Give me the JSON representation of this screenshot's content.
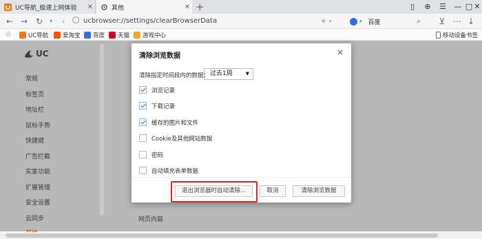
{
  "browser": {
    "tabs": [
      {
        "label": "UC导航_极速上网体验",
        "active": false
      },
      {
        "label": "其他",
        "active": true
      }
    ],
    "new_tab_symbol": "+",
    "window_controls": [
      "▯",
      "⊕",
      "☰",
      "—",
      "□",
      "✕"
    ],
    "address": "ucbrowser://settings/clearBrowserData",
    "search_engine": "百度",
    "bookmarks": [
      {
        "label": "UC导航",
        "icon_color": "#f07a16"
      },
      {
        "label": "爱淘宝",
        "icon_color": "#ff5000"
      },
      {
        "label": "百度",
        "icon_color": "#2f6fe0"
      },
      {
        "label": "天猫",
        "icon_color": "#d4001b"
      },
      {
        "label": "游戏中心",
        "icon_color": "#f2a623"
      }
    ],
    "mobile_bookmarks": "移动设备书签"
  },
  "settings": {
    "logo": "UC",
    "nav": [
      {
        "label": "常规"
      },
      {
        "label": "标签页"
      },
      {
        "label": "地址栏"
      },
      {
        "label": "鼠标手势"
      },
      {
        "label": "快捷键"
      },
      {
        "label": "广告拦截"
      },
      {
        "label": "实家功能"
      },
      {
        "label": "扩展管理"
      },
      {
        "label": "安全设置"
      },
      {
        "label": "云同步"
      },
      {
        "label": "其他"
      }
    ],
    "section_title": "网页内容"
  },
  "dialog": {
    "title": "清除浏览数据",
    "close": "×",
    "range_label": "清除指定时间段内的数据：",
    "range_value": "过去1周",
    "options": [
      {
        "label": "浏览记录",
        "checked": true
      },
      {
        "label": "下载记录",
        "checked": true
      },
      {
        "label": "缓存的图片和文件",
        "checked": true
      },
      {
        "label": "Cookie及其他网站数据",
        "checked": false
      },
      {
        "label": "密码",
        "checked": false
      },
      {
        "label": "自动填充表单数据",
        "checked": false
      }
    ],
    "buttons": {
      "auto_clear": "退出浏览器时自动清除...",
      "cancel": "取消",
      "clear": "清除浏览数据"
    }
  },
  "colors": {
    "accent": "#e86f00",
    "highlight": "#e02424",
    "check": "#2a6ebe"
  }
}
